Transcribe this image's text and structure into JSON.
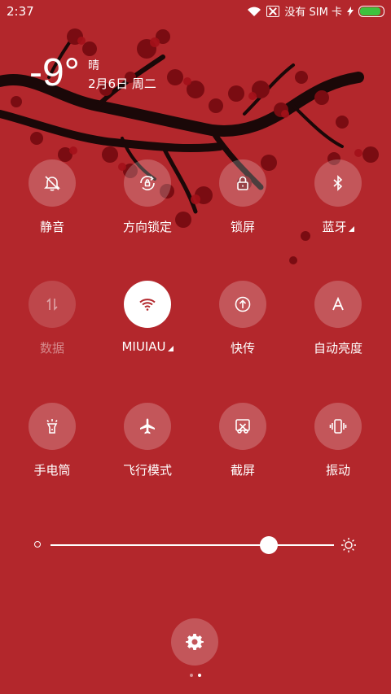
{
  "status_bar": {
    "time": "2:37",
    "carrier": "没有 SIM 卡",
    "battery_level": 0.95,
    "battery_color": "#3ec23e"
  },
  "lock": {
    "temperature": "-9°",
    "condition": "晴",
    "date": "2月6日 周二"
  },
  "toggles": {
    "row1": [
      {
        "label": "静音",
        "icon": "bell-off-icon"
      },
      {
        "label": "方向锁定",
        "icon": "rotation-lock-icon"
      },
      {
        "label": "锁屏",
        "icon": "lock-icon"
      },
      {
        "label": "蓝牙",
        "icon": "bluetooth-icon"
      }
    ],
    "row2": [
      {
        "label": "数据",
        "icon": "data-arrows-icon",
        "state": "disabled"
      },
      {
        "label": "MIUIAU",
        "icon": "wifi-icon",
        "state": "active"
      },
      {
        "label": "快传",
        "icon": "upload-icon"
      },
      {
        "label": "自动亮度",
        "icon": "auto-brightness-icon"
      }
    ],
    "row3": [
      {
        "label": "手电筒",
        "icon": "flashlight-icon"
      },
      {
        "label": "飞行模式",
        "icon": "airplane-icon"
      },
      {
        "label": "截屏",
        "icon": "screenshot-icon"
      },
      {
        "label": "振动",
        "icon": "vibrate-icon"
      }
    ]
  },
  "brightness": {
    "level": 0.77
  },
  "pager": {
    "current": 2,
    "total": 2
  },
  "colors": {
    "background": "#b3272c",
    "accent": "#b3272c"
  }
}
